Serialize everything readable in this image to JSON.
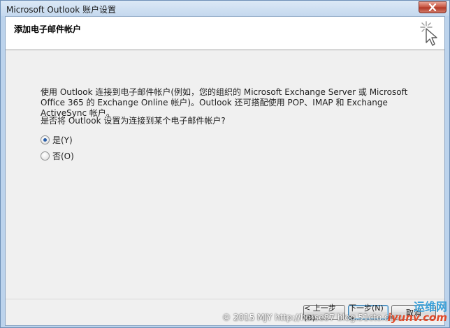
{
  "window": {
    "title": "Microsoft Outlook 账户设置"
  },
  "header": {
    "title": "添加电子邮件帐户"
  },
  "content": {
    "description": "使用 Outlook 连接到电子邮件帐户(例如，您的组织的 Microsoft Exchange Server 或 Microsoft Office 365 的 Exchange Online 帐户)。Outlook 还可搭配使用 POP、IMAP 和 Exchange ActiveSync 帐户。",
    "question": "是否将 Outlook 设置为连接到某个电子邮件帐户?",
    "options": [
      {
        "label": "是(Y)",
        "selected": true
      },
      {
        "label": "否(O)",
        "selected": false
      }
    ]
  },
  "footer": {
    "back_label": "< 上一步(B)",
    "next_label": "下一步(N) >",
    "cancel_label": "取消"
  },
  "watermark": {
    "text": "© 2015 MJY http://horse87 blog.51cto.com"
  },
  "logo": {
    "top": "运维网",
    "bottom": "iyunv.com"
  },
  "colors": {
    "accent": "#2a5ea8",
    "titlebar": "#c4d8ee",
    "close": "#c4503c"
  },
  "icons": {
    "wizard": "wand-sparkle-icon",
    "close": "close-icon"
  }
}
